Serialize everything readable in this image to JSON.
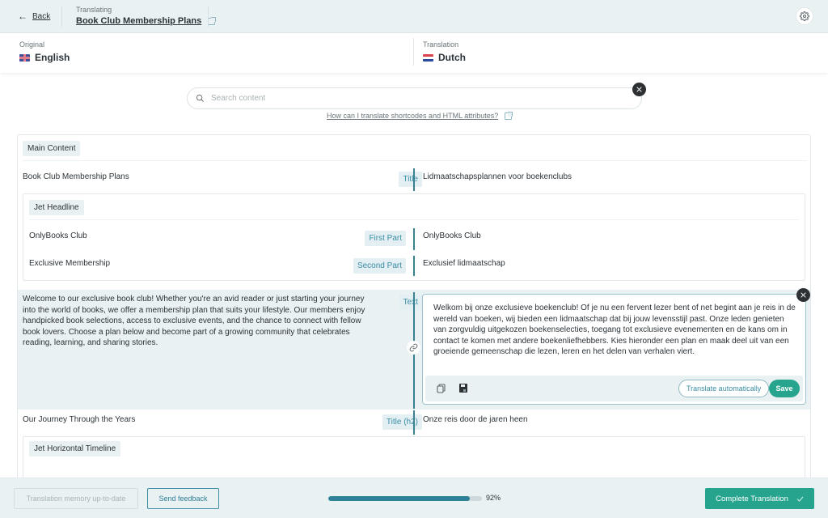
{
  "header": {
    "back_label": "Back",
    "translating_caption": "Translating",
    "page_title": "Book Club Membership Plans"
  },
  "languages": {
    "original_caption": "Original",
    "original_name": "English",
    "translation_caption": "Translation",
    "translation_name": "Dutch"
  },
  "search": {
    "placeholder": "Search content",
    "value": "",
    "help_link": "How can I translate shortcodes and HTML attributes?"
  },
  "sections": {
    "main_content_label": "Main Content",
    "title_row": {
      "source": "Book Club Membership Plans",
      "tag": "Title",
      "target": "Lidmaatschapsplannen voor boekenclubs"
    },
    "jet_headline": {
      "label": "Jet Headline",
      "rows": [
        {
          "source": "OnlyBooks Club",
          "tag": "First Part",
          "target": "OnlyBooks Club"
        },
        {
          "source": "Exclusive Membership",
          "tag": "Second Part",
          "target": "Exclusief lidmaatschap"
        }
      ]
    },
    "text_row": {
      "source": "Welcome to our exclusive book club! Whether you're an avid reader or just starting your journey into the world of books, we offer a membership plan that suits your lifestyle. Our members enjoy handpicked book selections, access to exclusive events, and the chance to connect with fellow book lovers. Choose a plan below and become part of a growing community that celebrates reading, learning, and sharing stories.",
      "tag": "Text",
      "target": "Welkom bij onze exclusieve boekenclub! Of je nu een fervent lezer bent of net begint aan je reis in de wereld van boeken, wij bieden een lidmaatschap dat bij jouw levensstijl past. Onze leden genieten van zorgvuldig uitgekozen boekenselecties, toegang tot exclusieve evenementen en de kans om in contact te komen met andere boekenliefhebbers. Kies hieronder een plan en maak deel uit van een groeiende gemeenschap die lezen, leren en het delen van verhalen viert.",
      "translate_auto_label": "Translate automatically",
      "save_label": "Save"
    },
    "journey_row": {
      "source": "Our Journey Through the Years",
      "tag": "Title (h2)",
      "target": "Onze reis door de jaren heen"
    },
    "timeline_label": "Jet Horizontal Timeline"
  },
  "footer": {
    "memory_label": "Translation memory up-to-date",
    "feedback_label": "Send feedback",
    "progress_percent": 92,
    "progress_label": "92%",
    "complete_label": "Complete Translation"
  }
}
